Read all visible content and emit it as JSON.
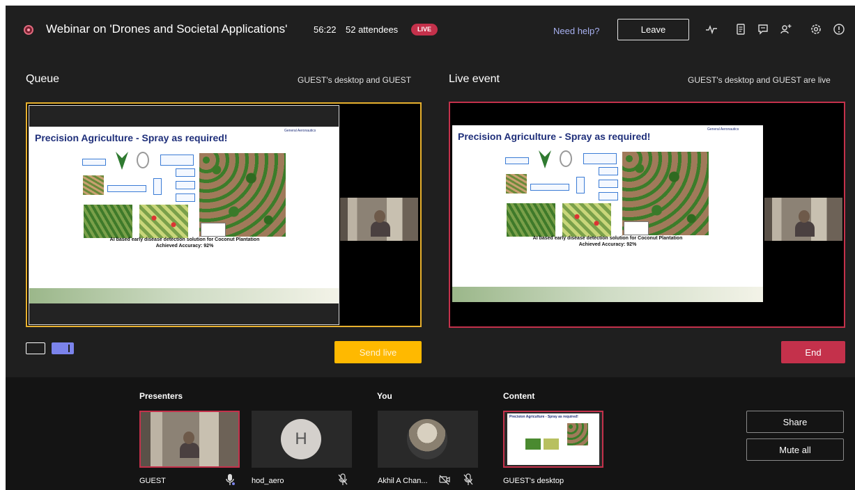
{
  "topbar": {
    "title": "Webinar on 'Drones and Societal Applications'",
    "timer": "56:22",
    "attendees": "52 attendees",
    "live_badge": "LIVE",
    "help": "Need help?",
    "leave": "Leave",
    "icons": [
      "health-icon",
      "notes-icon",
      "chat-icon",
      "people-add-icon",
      "settings-icon",
      "info-icon"
    ]
  },
  "queue": {
    "label": "Queue",
    "sources": "GUEST's desktop and GUEST"
  },
  "live": {
    "label": "Live event",
    "sources": "GUEST's desktop and GUEST are live"
  },
  "slide": {
    "title": "Precision Agriculture - Spray as required!",
    "brand": "General Aeronautics",
    "caption_line1": "AI based early disease detection solution for Coconut Plantation",
    "caption_line2": "Achieved Accuracy: 92%"
  },
  "actions": {
    "send_live": "Send live",
    "end": "End"
  },
  "bottom": {
    "presenters_label": "Presenters",
    "you_label": "You",
    "content_label": "Content",
    "tiles": [
      {
        "name": "GUEST"
      },
      {
        "name": "hod_aero",
        "initial": "H"
      },
      {
        "name": "Akhil A Chan..."
      },
      {
        "name": "GUEST's desktop"
      }
    ],
    "share": "Share",
    "mute_all": "Mute all"
  },
  "colors": {
    "background": "#1f1f1f",
    "queue_border": "#e8b12e",
    "live_accent": "#c4314b",
    "send_live": "#ffb900",
    "link": "#a7b0f0"
  }
}
